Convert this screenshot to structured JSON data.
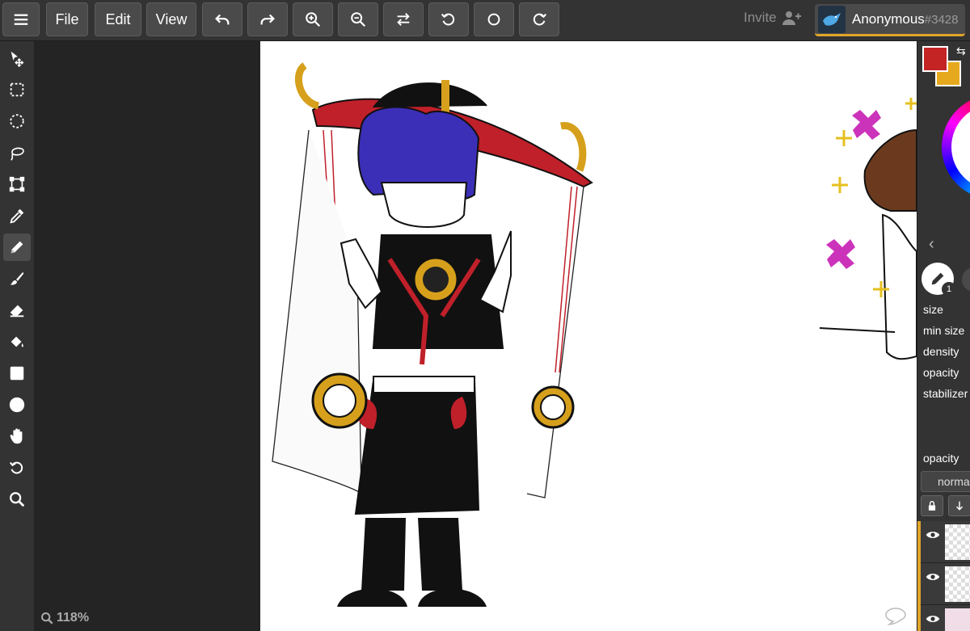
{
  "topbar": {
    "file_label": "File",
    "edit_label": "Edit",
    "view_label": "View",
    "invite_label": "Invite",
    "user_name": "Anonymous",
    "user_tag": "#3428"
  },
  "canvas": {
    "zoom": "118%"
  },
  "colors": {
    "primary": "#c42424",
    "secondary": "#e6a81c",
    "accent": "#e0a52a"
  },
  "tools": [
    "move-tool",
    "rect-select-tool",
    "ellipse-select-tool",
    "lasso-tool",
    "transform-tool",
    "eyedropper-tool",
    "pen-tool",
    "brush-tool",
    "eraser-tool",
    "fill-tool",
    "rectangle-tool",
    "ellipse-tool",
    "hand-tool",
    "rotate-tool",
    "zoom-tool"
  ],
  "brush": {
    "badge": "1",
    "props": {
      "size": "size",
      "min_size": "min size",
      "density": "density",
      "opacity": "opacity",
      "stabilizer": "stabilizer"
    }
  },
  "layers": {
    "opacity_label": "opacity",
    "blend_mode": "normal"
  }
}
